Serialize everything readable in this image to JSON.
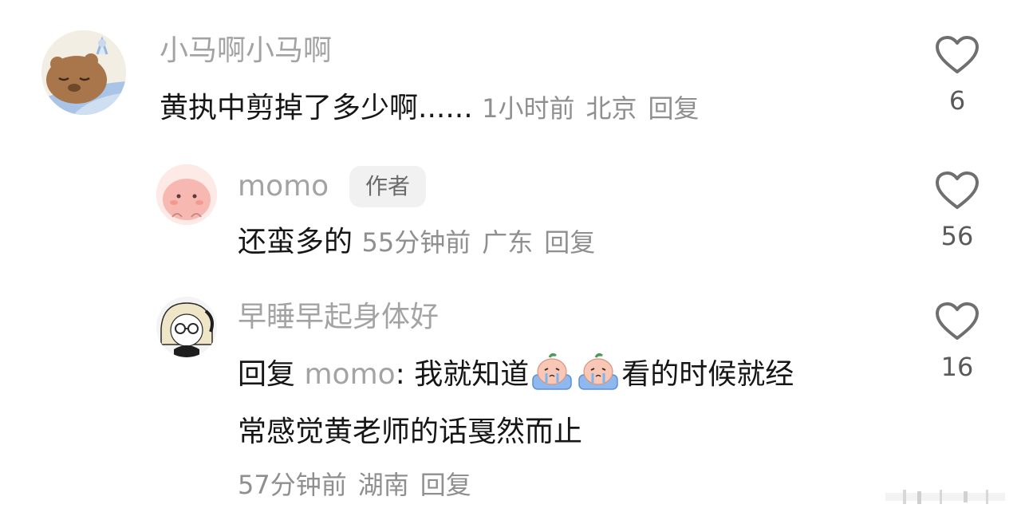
{
  "comments": [
    {
      "username": "小马啊小马啊",
      "text": "黄执中剪掉了多少啊......",
      "time": "1小时前",
      "location": "北京",
      "reply_label": "回复",
      "likes": "6",
      "avatar_icon": "bear-sleeping-avatar"
    },
    {
      "username": "momo",
      "badge": "作者",
      "text": "还蛮多的",
      "time": "55分钟前",
      "location": "广东",
      "reply_label": "回复",
      "likes": "56",
      "avatar_icon": "pink-blob-avatar"
    },
    {
      "username": "早睡早起身体好",
      "reply_prefix": "回复",
      "reply_to": "momo",
      "text_part1": ": 我就知道",
      "text_part2": "看的时候就经",
      "text_line2": "常感觉黄老师的话戛然而止",
      "time": "57分钟前",
      "location": "湖南",
      "reply_label": "回复",
      "likes": "16",
      "avatar_icon": "anime-girl-glasses-avatar",
      "emoji_icon": "crying-peach-emoji"
    }
  ],
  "colors": {
    "username": "#a3a3a3",
    "text": "#161616",
    "meta": "#8f8f8f",
    "badge_bg": "#f1f1f1",
    "heart": "#6f6f6f"
  }
}
